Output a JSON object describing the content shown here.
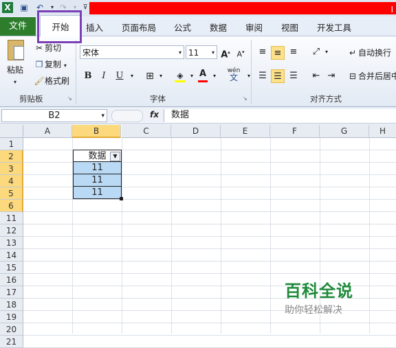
{
  "titlebar": {
    "title_fragment": "I"
  },
  "tabs": {
    "file": "文件",
    "home": "开始",
    "insert": "插入",
    "page_layout": "页面布局",
    "formulas": "公式",
    "data": "数据",
    "review": "审阅",
    "view": "视图",
    "developer": "开发工具"
  },
  "ribbon": {
    "clipboard": {
      "paste": "粘贴",
      "cut": "剪切",
      "copy": "复制",
      "format_painter": "格式刷",
      "group_label": "剪贴板"
    },
    "font": {
      "font_name": "宋体",
      "font_size": "11",
      "bold": "B",
      "italic": "I",
      "underline": "U",
      "group_label": "字体",
      "font_color": "A",
      "phonetic": "wén"
    },
    "alignment": {
      "wrap_text": "自动换行",
      "merge_center": "合并后居中",
      "group_label": "对齐方式"
    }
  },
  "formula_bar": {
    "name_box": "B2",
    "fx": "fx",
    "content": "数据"
  },
  "columns": [
    "A",
    "B",
    "C",
    "D",
    "E",
    "F",
    "G",
    "H"
  ],
  "rows": [
    "1",
    "2",
    "3",
    "4",
    "5",
    "6",
    "11",
    "12",
    "13",
    "14",
    "15",
    "16",
    "17",
    "18",
    "19",
    "20",
    "21"
  ],
  "table": {
    "header": "数据",
    "values": [
      "11",
      "11",
      "11"
    ]
  },
  "watermark": {
    "title": "百科全说",
    "subtitle": "助你轻松解决"
  },
  "colors": {
    "file_tab": "#2d7d2d",
    "highlight_box": "#7b3fb5",
    "title_red": "#ff0000",
    "cell_fill": "#b9d9f5",
    "selected_header": "#fbd97c"
  }
}
